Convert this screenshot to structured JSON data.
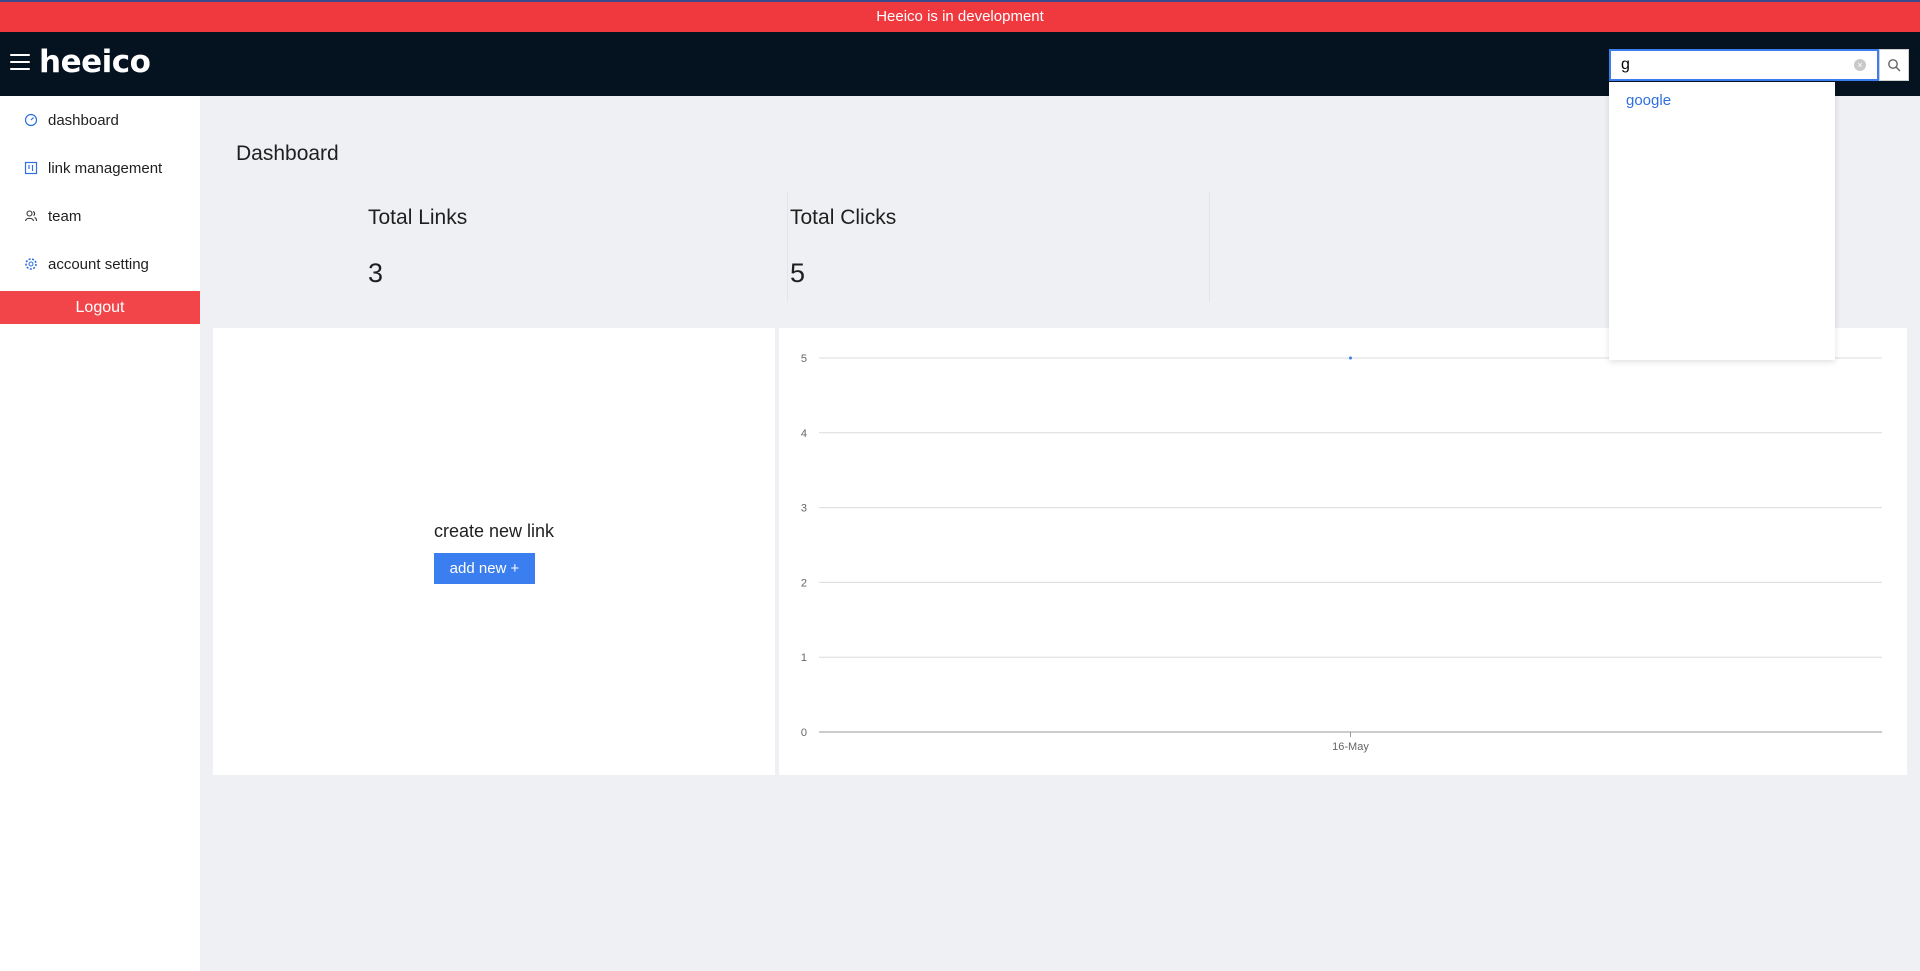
{
  "banner": {
    "text": "Heeico is in development"
  },
  "header": {
    "logo": "heeico",
    "search": {
      "value": "g",
      "placeholder": ""
    },
    "search_suggestions": [
      "google"
    ]
  },
  "sidebar": {
    "items": [
      {
        "label": "dashboard",
        "icon": "dashboard-icon"
      },
      {
        "label": "link management",
        "icon": "link-management-icon"
      },
      {
        "label": "team",
        "icon": "team-icon"
      },
      {
        "label": "account setting",
        "icon": "gear-icon"
      }
    ],
    "logout_label": "Logout"
  },
  "main": {
    "title": "Dashboard",
    "stats": [
      {
        "label": "Total Links",
        "value": "3"
      },
      {
        "label": "Total Clicks",
        "value": "5"
      }
    ],
    "create": {
      "label": "create new link",
      "button": "add new +"
    }
  },
  "colors": {
    "banner": "#f0383f",
    "header": "#051320",
    "accent": "#3b7ef0",
    "logout": "#f1454a",
    "background": "#eef0f4"
  },
  "chart_data": {
    "type": "line",
    "x": [
      "16-May"
    ],
    "series": [
      {
        "values": [
          5
        ]
      }
    ],
    "ylim": [
      0,
      5
    ],
    "yticks": [
      0,
      1,
      2,
      3,
      4,
      5
    ],
    "grid": true,
    "title": "",
    "xlabel": "",
    "ylabel": ""
  }
}
